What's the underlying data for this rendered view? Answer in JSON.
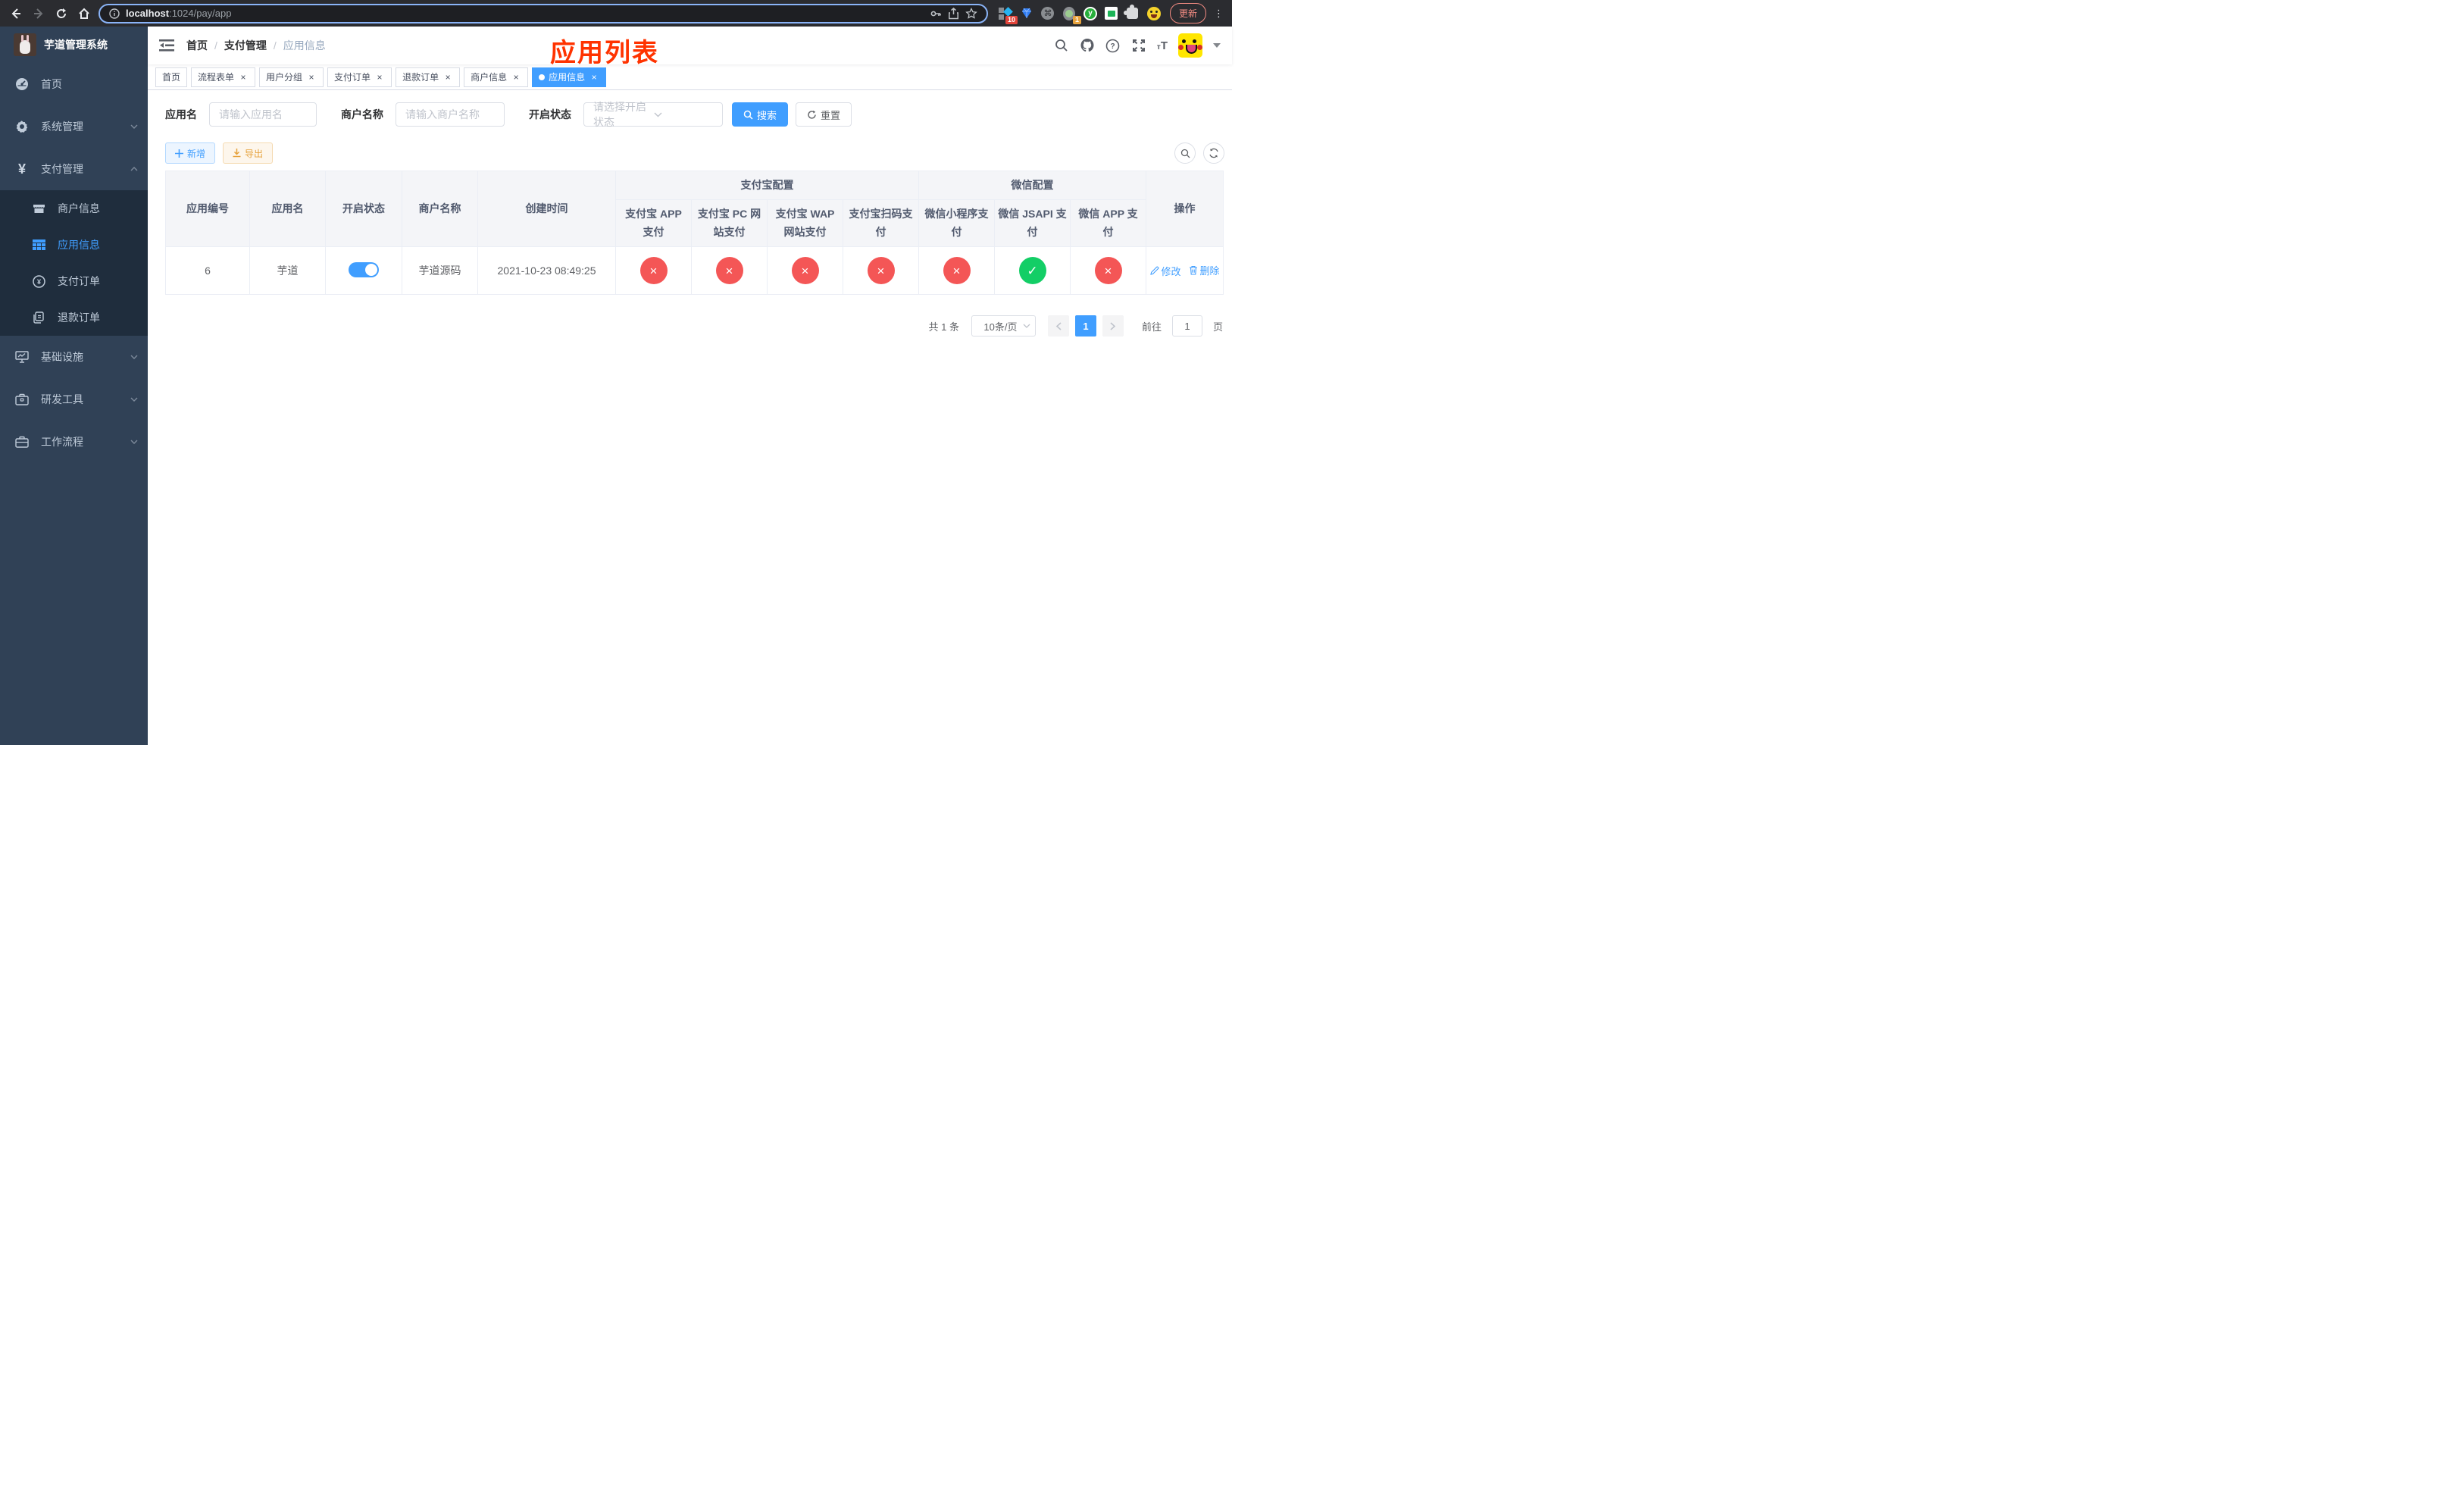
{
  "browser": {
    "url_host": "localhost",
    "url_rest": ":1024/pay/app",
    "ext_badge_tasks": "10",
    "ext_badge_one": "1",
    "update_label": "更新"
  },
  "annotation": {
    "title": "应用列表"
  },
  "sidebar": {
    "app_title": "芋道管理系统",
    "items": [
      {
        "label": "首页"
      },
      {
        "label": "系统管理"
      },
      {
        "label": "支付管理"
      },
      {
        "label": "基础设施"
      },
      {
        "label": "研发工具"
      },
      {
        "label": "工作流程"
      }
    ],
    "pay_submenu": [
      {
        "label": "商户信息"
      },
      {
        "label": "应用信息"
      },
      {
        "label": "支付订单"
      },
      {
        "label": "退款订单"
      }
    ]
  },
  "header": {
    "breadcrumb": [
      {
        "label": "首页"
      },
      {
        "label": "支付管理"
      },
      {
        "label": "应用信息"
      }
    ]
  },
  "tags": [
    {
      "label": "首页"
    },
    {
      "label": "流程表单"
    },
    {
      "label": "用户分组"
    },
    {
      "label": "支付订单"
    },
    {
      "label": "退款订单"
    },
    {
      "label": "商户信息"
    },
    {
      "label": "应用信息"
    }
  ],
  "filters": {
    "app_name_label": "应用名",
    "app_name_placeholder": "请输入应用名",
    "merchant_label": "商户名称",
    "merchant_placeholder": "请输入商户名称",
    "status_label": "开启状态",
    "status_placeholder": "请选择开启状态",
    "search_label": "搜索",
    "reset_label": "重置"
  },
  "toolbar": {
    "add_label": "新增",
    "export_label": "导出"
  },
  "table": {
    "columns": [
      "应用编号",
      "应用名",
      "开启状态",
      "商户名称",
      "创建时间"
    ],
    "groups": [
      {
        "label": "支付宝配置",
        "children": [
          "支付宝 APP 支付",
          "支付宝 PC 网站支付",
          "支付宝 WAP 网站支付",
          "支付宝扫码支付"
        ]
      },
      {
        "label": "微信配置",
        "children": [
          "微信小程序支付",
          "微信 JSAPI 支付",
          "微信 APP 支付"
        ]
      }
    ],
    "action_column": "操作",
    "row": {
      "id": "6",
      "name": "芋道",
      "enabled": true,
      "merchant": "芋道源码",
      "created_at": "2021-10-23 08:49:25",
      "pay_status": [
        "no",
        "no",
        "no",
        "no",
        "no",
        "yes",
        "no"
      ],
      "edit_label": "修改",
      "delete_label": "删除"
    }
  },
  "pagination": {
    "total_text": "共 1 条",
    "page_size": "10条/页",
    "current_page": "1",
    "goto_label": "前往",
    "goto_value": "1",
    "page_unit": "页"
  },
  "colors": {
    "accent": "#409eff",
    "success": "#13ce66",
    "danger": "#f45656",
    "warning": "#e6a23c",
    "sidebar_bg": "#304156",
    "submenu_bg": "#1f2d3d",
    "annotation_red": "#ff3300"
  }
}
